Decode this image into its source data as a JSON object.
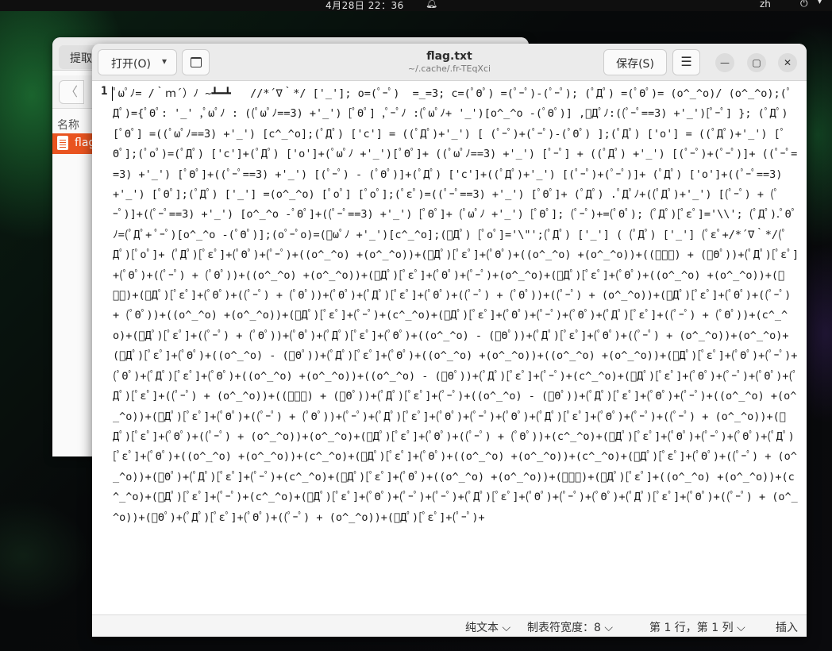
{
  "topbar": {
    "clock": "4月28日  22：36",
    "bell_icon": "bell-icon",
    "input_method": "zh",
    "power_icon": "power-icon"
  },
  "file_manager": {
    "extract_label": "提取",
    "back_icon": "back-arrow-icon",
    "column_name": "名称",
    "file_icon": "text-file-icon",
    "file_name": "flag"
  },
  "editor": {
    "open_label": "打开(O)",
    "open_chevron": "⌵",
    "new_tab_icon": "new-tab-icon",
    "title": "flag.txt",
    "subtitle": "~/.cache/.fr-TEqXci",
    "save_label": "保存(S)",
    "menu_icon": "☰",
    "minimize_icon": "—",
    "maximize_icon": "▢",
    "close_icon": "✕",
    "line_number": "1",
    "code": "ﾟωﾟﾉ= /｀ｍ´）ﾉ ~┻━┻   //*´∇｀*/ ['_']; o=(ﾟｰﾟ)  =_=3; c=(ﾟΘﾟ) =(ﾟｰﾟ)-(ﾟｰﾟ); (ﾟДﾟ) =(ﾟΘﾟ)= (o^_^o)/ (o^_^o);(ﾟДﾟ)={ﾟΘﾟ: '_' ,ﾟωﾟﾉ : ((ﾟωﾟﾉ==3) +'_') [ﾟΘﾟ] ,ﾟｰﾟﾉ :(ﾟωﾟﾉ+ '_')[o^_^o -(ﾟΘﾟ)] ,ﾟДﾟﾉ:((ﾟｰﾟ==3) +'_')[ﾟｰﾟ] }; (ﾟДﾟ) [ﾟΘﾟ] =((ﾟωﾟﾉ==3) +'_') [c^_^o];(ﾟДﾟ) ['c'] = ((ﾟДﾟ)+'_') [ (ﾟｰﾟ)+(ﾟｰﾟ)-(ﾟΘﾟ) ];(ﾟДﾟ) ['o'] = ((ﾟДﾟ)+'_') [ﾟΘﾟ];(ﾟoﾟ)=(ﾟДﾟ) ['c']+(ﾟДﾟ) ['o']+(ﾟωﾟﾉ +'_')[ﾟΘﾟ]+ ((ﾟωﾟﾉ==3) +'_') [ﾟｰﾟ] + ((ﾟДﾟ) +'_') [(ﾟｰﾟ)+(ﾟｰﾟ)]+ ((ﾟｰﾟ==3) +'_') [ﾟΘﾟ]+((ﾟｰﾟ==3) +'_') [(ﾟｰﾟ) - (ﾟΘﾟ)]+(ﾟДﾟ) ['c']+((ﾟДﾟ)+'_') [(ﾟｰﾟ)+(ﾟｰﾟ)]+ (ﾟДﾟ) ['o']+((ﾟｰﾟ==3) +'_') [ﾟΘﾟ];(ﾟДﾟ) ['_'] =(o^_^o) [ﾟoﾟ] [ﾟoﾟ];(ﾟεﾟ)=((ﾟｰﾟ==3) +'_') [ﾟΘﾟ]+ (ﾟДﾟ) .ﾟДﾟﾉ+((ﾟДﾟ)+'_') [(ﾟｰﾟ) + (ﾟｰﾟ)]+((ﾟｰﾟ==3) +'_') [o^_^o -ﾟΘﾟ]+((ﾟｰﾟ==3) +'_') [ﾟΘﾟ]+ (ﾟωﾟﾉ +'_') [ﾟΘﾟ]; (ﾟｰﾟ)+=(ﾟΘﾟ); (ﾟДﾟ)[ﾟεﾟ]='\\\\'; (ﾟДﾟ).ﾟΘﾟﾉ=(ﾟДﾟ+ ﾟｰﾟ)[o^_^o -(ﾟΘﾟ)];(oﾟｰﾟo)=(ﾟωﾟﾉ +'_')[c^_^o];(ﾟДﾟ) [ﾟoﾟ]='\\\"';(ﾟДﾟ) ['_'] ( (ﾟДﾟ) ['_'] (ﾟεﾟ+/*´∇｀*/(ﾟДﾟ)[ﾟoﾟ]+ (ﾟДﾟ)[ﾟεﾟ]+(ﾟΘﾟ)+(ﾟｰﾟ)+((o^_^o) +(o^_^o))+(ﾟДﾟ)[ﾟεﾟ]+(ﾟΘﾟ)+((o^_^o) +(o^_^o))+((ﾟｰﾟ) + (ﾟΘﾟ))+(ﾟДﾟ)[ﾟεﾟ]+(ﾟΘﾟ)+((ﾟｰﾟ) + (ﾟΘﾟ))+((o^_^o) +(o^_^o))+(ﾟДﾟ)[ﾟεﾟ]+(ﾟΘﾟ)+(ﾟｰﾟ)+(o^_^o)+(ﾟДﾟ)[ﾟεﾟ]+(ﾟΘﾟ)+((o^_^o) +(o^_^o))+(ﾟｰﾟ)+(ﾟДﾟ)[ﾟεﾟ]+(ﾟΘﾟ)+((ﾟｰﾟ) + (ﾟΘﾟ))+(ﾟΘﾟ)+(ﾟДﾟ)[ﾟεﾟ]+(ﾟΘﾟ)+((ﾟｰﾟ) + (ﾟΘﾟ))+((ﾟｰﾟ) + (o^_^o))+(ﾟДﾟ)[ﾟεﾟ]+(ﾟΘﾟ)+((ﾟｰﾟ) + (ﾟΘﾟ))+((o^_^o) +(o^_^o))+(ﾟДﾟ)[ﾟεﾟ]+(ﾟｰﾟ)+(c^_^o)+(ﾟДﾟ)[ﾟεﾟ]+(ﾟΘﾟ)+(ﾟｰﾟ)+(ﾟΘﾟ)+(ﾟДﾟ)[ﾟεﾟ]+((ﾟｰﾟ) + (ﾟΘﾟ))+(c^_^o)+(ﾟДﾟ)[ﾟεﾟ]+((ﾟｰﾟ) + (ﾟΘﾟ))+(ﾟΘﾟ)+(ﾟДﾟ)[ﾟεﾟ]+(ﾟΘﾟ)+((o^_^o) - (ﾟΘﾟ))+(ﾟДﾟ)[ﾟεﾟ]+(ﾟΘﾟ)+((ﾟｰﾟ) + (o^_^o))+(o^_^o)+(ﾟДﾟ)[ﾟεﾟ]+(ﾟΘﾟ)+((o^_^o) - (ﾟΘﾟ))+(ﾟДﾟ)[ﾟεﾟ]+(ﾟΘﾟ)+((o^_^o) +(o^_^o))+((o^_^o) +(o^_^o))+(ﾟДﾟ)[ﾟεﾟ]+(ﾟΘﾟ)+(ﾟｰﾟ)+(ﾟΘﾟ)+(ﾟДﾟ)[ﾟεﾟ]+(ﾟΘﾟ)+((o^_^o) +(o^_^o))+((o^_^o) - (ﾟΘﾟ))+(ﾟДﾟ)[ﾟεﾟ]+(ﾟｰﾟ)+(c^_^o)+(ﾟДﾟ)[ﾟεﾟ]+(ﾟΘﾟ)+(ﾟｰﾟ)+(ﾟΘﾟ)+(ﾟДﾟ)[ﾟεﾟ]+((ﾟｰﾟ) + (o^_^o))+((ﾟｰﾟ) + (ﾟΘﾟ))+(ﾟДﾟ)[ﾟεﾟ]+(ﾟｰﾟ)+((o^_^o) - (ﾟΘﾟ))+(ﾟДﾟ)[ﾟεﾟ]+(ﾟΘﾟ)+(ﾟｰﾟ)+((o^_^o) +(o^_^o))+(ﾟДﾟ)[ﾟεﾟ]+(ﾟΘﾟ)+((ﾟｰﾟ) + (ﾟΘﾟ))+(ﾟｰﾟ)+(ﾟДﾟ)[ﾟεﾟ]+(ﾟΘﾟ)+(ﾟｰﾟ)+(ﾟΘﾟ)+(ﾟДﾟ)[ﾟεﾟ]+(ﾟΘﾟ)+(ﾟｰﾟ)+((ﾟｰﾟ) + (o^_^o))+(ﾟДﾟ)[ﾟεﾟ]+(ﾟΘﾟ)+((ﾟｰﾟ) + (o^_^o))+(o^_^o)+(ﾟДﾟ)[ﾟεﾟ]+(ﾟΘﾟ)+((ﾟｰﾟ) + (ﾟΘﾟ))+(c^_^o)+(ﾟДﾟ)[ﾟεﾟ]+(ﾟΘﾟ)+(ﾟｰﾟ)+(ﾟΘﾟ)+(ﾟДﾟ)[ﾟεﾟ]+(ﾟΘﾟ)+((o^_^o) +(o^_^o))+(c^_^o)+(ﾟДﾟ)[ﾟεﾟ]+(ﾟΘﾟ)+((o^_^o) +(o^_^o))+(c^_^o)+(ﾟДﾟ)[ﾟεﾟ]+(ﾟΘﾟ)+((ﾟｰﾟ) + (o^_^o))+(ﾟΘﾟ)+(ﾟДﾟ)[ﾟεﾟ]+(ﾟｰﾟ)+(c^_^o)+(ﾟДﾟ)[ﾟεﾟ]+(ﾟΘﾟ)+((o^_^o) +(o^_^o))+(ﾟｰﾟ)+(ﾟДﾟ)[ﾟεﾟ]+((o^_^o) +(o^_^o))+(c^_^o)+(ﾟДﾟ)[ﾟεﾟ]+(ﾟｰﾟ)+(c^_^o)+(ﾟДﾟ)[ﾟεﾟ]+(ﾟΘﾟ)+(ﾟｰﾟ)+(ﾟｰﾟ)+(ﾟДﾟ)[ﾟεﾟ]+(ﾟΘﾟ)+(ﾟｰﾟ)+(ﾟΘﾟ)+(ﾟДﾟ)[ﾟεﾟ]+(ﾟΘﾟ)+((ﾟｰﾟ) + (o^_^o))+(ﾟΘﾟ)+(ﾟДﾟ)[ﾟεﾟ]+(ﾟΘﾟ)+((ﾟｰﾟ) + (o^_^o))+(ﾟДﾟ)[ﾟεﾟ]+(ﾟｰﾟ)+"
  },
  "statusbar": {
    "language": "纯文本 ⌵",
    "tab_width": "制表符宽度：8 ⌵",
    "position": "第 1 行，第 1 列   ⌵",
    "insert_mode": "插入"
  },
  "colors": {
    "accent": "#e95420",
    "header_bg": "#ebebeb",
    "text": "#1a1a1a"
  }
}
